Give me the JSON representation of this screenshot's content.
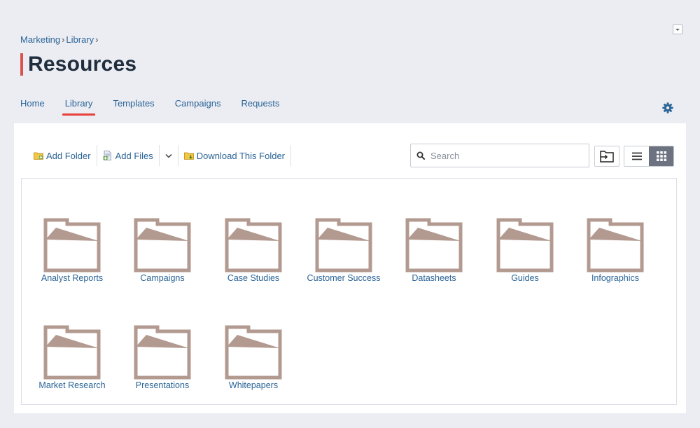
{
  "breadcrumb": {
    "items": [
      "Marketing",
      "Library"
    ],
    "separator": "›"
  },
  "page": {
    "title": "Resources"
  },
  "tabs": [
    {
      "label": "Home"
    },
    {
      "label": "Library",
      "active": true
    },
    {
      "label": "Templates"
    },
    {
      "label": "Campaigns"
    },
    {
      "label": "Requests"
    }
  ],
  "toolbar": {
    "add_folder": "Add Folder",
    "add_files": "Add Files",
    "download_folder": "Download This Folder"
  },
  "search": {
    "placeholder": "Search",
    "value": ""
  },
  "view": {
    "mode": "grid"
  },
  "folders": [
    "Analyst Reports",
    "Campaigns",
    "Case Studies",
    "Customer Success",
    "Datasheets",
    "Guides",
    "Infographics",
    "Market Research",
    "Presentations",
    "Whitepapers"
  ],
  "colors": {
    "folder": "#b39a90",
    "accent_red": "#e8403a",
    "link": "#2a6496",
    "title": "#1f2d3d",
    "gear": "#2a6496"
  },
  "icons": {
    "toolbar": [
      "folder-add-icon",
      "file-add-icon",
      "chevron-down-icon",
      "folder-download-icon"
    ],
    "search": "search-icon",
    "move": "move-folder-icon",
    "views": [
      "list-view-icon",
      "grid-view-icon"
    ],
    "settings": "gear-icon"
  }
}
